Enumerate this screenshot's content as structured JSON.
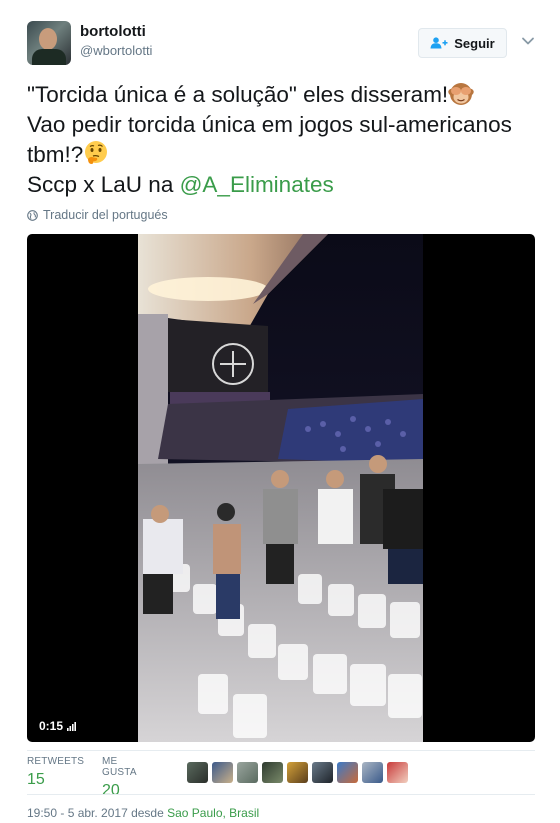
{
  "user": {
    "display_name": "bortolotti",
    "handle": "@wbortolotti"
  },
  "follow_button": {
    "label": "Seguir"
  },
  "tweet": {
    "line1": "\"Torcida única é a solução\" eles disseram!",
    "line2": "Vao pedir torcida única em jogos sul-americanos tbm!?",
    "line3_prefix": "Sccp x LaU na ",
    "mention": "@A_Eliminates",
    "emoji1": "see-no-evil-monkey",
    "emoji2": "thinking-face"
  },
  "translate": {
    "label": "Traducir del portugués"
  },
  "media": {
    "timecode": "0:15"
  },
  "stats": {
    "retweets_label": "RETWEETS",
    "retweets_value": "15",
    "likes_label": "ME GUSTA",
    "likes_value": "20"
  },
  "timestamp": {
    "text": "19:50 - 5 abr. 2017 desde ",
    "place": "Sao Paulo, Brasil"
  },
  "colors": {
    "link": "#3a9c4a",
    "muted": "#657786",
    "text": "#14171a"
  }
}
